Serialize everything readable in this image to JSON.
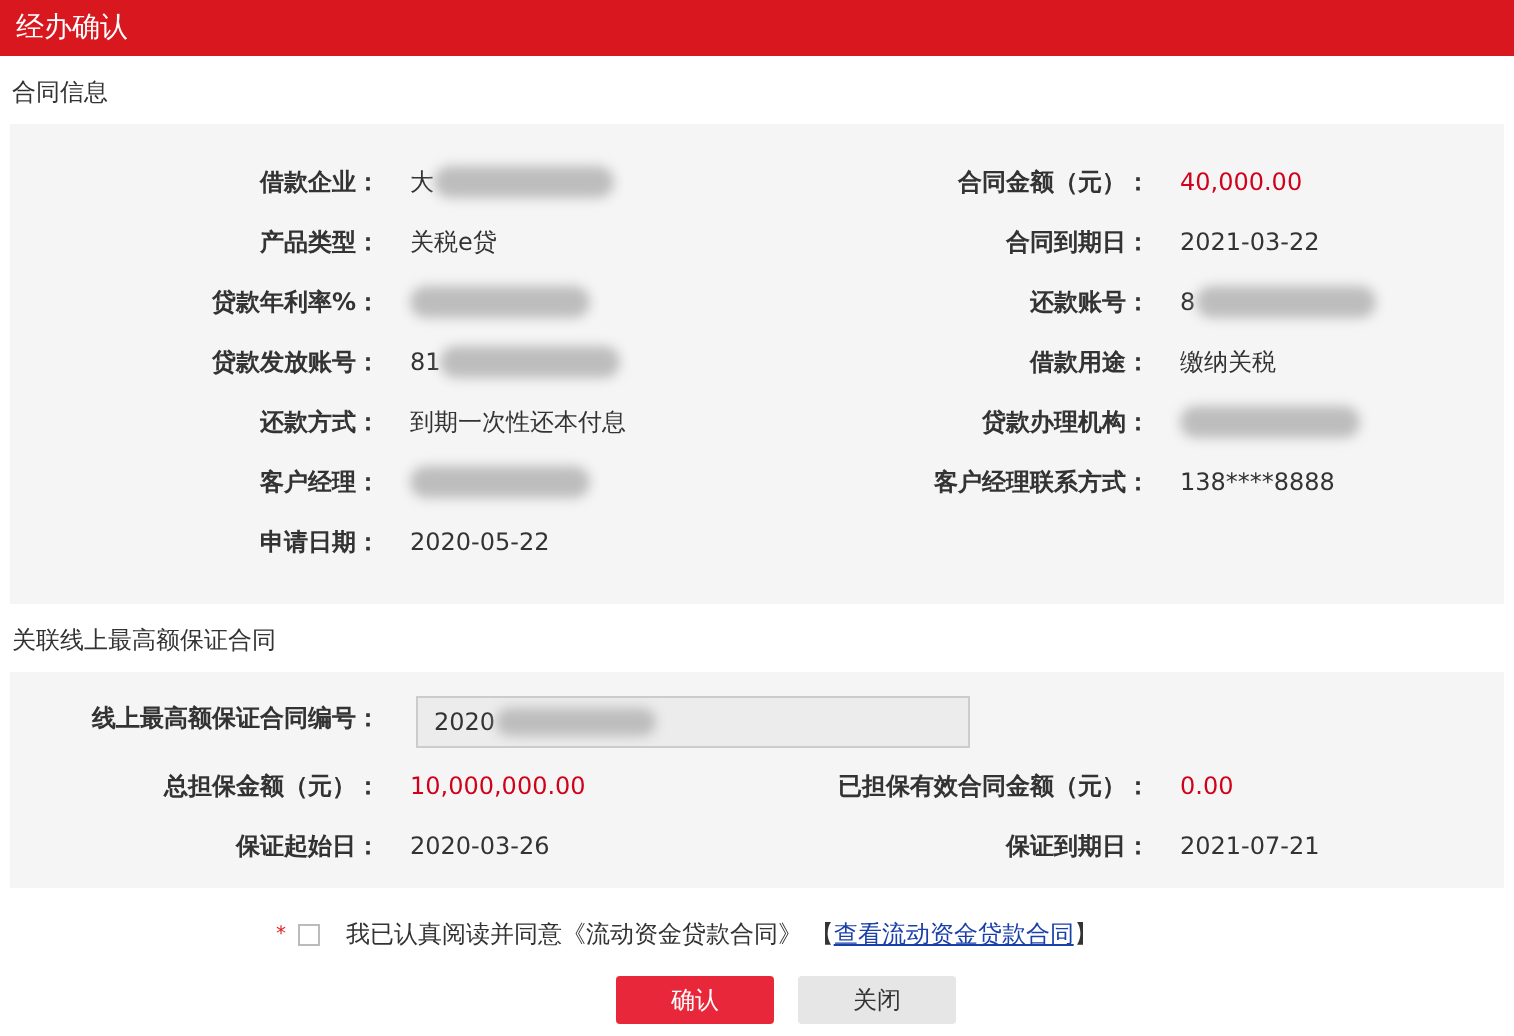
{
  "dialog": {
    "title": "经办确认"
  },
  "contract_info": {
    "heading": "合同信息",
    "rows": [
      {
        "left": {
          "label": "借款企业：",
          "kind": "redacted",
          "value": "大"
        },
        "right": {
          "label": "合同金额（元）：",
          "kind": "amount",
          "value": "40,000.00"
        }
      },
      {
        "left": {
          "label": "产品类型：",
          "kind": "plain",
          "value": "关税e贷"
        },
        "right": {
          "label": "合同到期日：",
          "kind": "plain",
          "value": "2021-03-22"
        }
      },
      {
        "left": {
          "label": "贷款年利率%：",
          "kind": "redacted"
        },
        "right": {
          "label": "还款账号：",
          "kind": "redacted",
          "value": "8"
        }
      },
      {
        "left": {
          "label": "贷款发放账号：",
          "kind": "redacted",
          "value": "81"
        },
        "right": {
          "label": "借款用途：",
          "kind": "plain",
          "value": "缴纳关税"
        }
      },
      {
        "left": {
          "label": "还款方式：",
          "kind": "plain",
          "value": "到期一次性还本付息"
        },
        "right": {
          "label": "贷款办理机构：",
          "kind": "redacted"
        }
      },
      {
        "left": {
          "label": "客户经理：",
          "kind": "redacted"
        },
        "right": {
          "label": "客户经理联系方式：",
          "kind": "plain",
          "value": "138****8888"
        }
      },
      {
        "left": {
          "label": "申请日期：",
          "kind": "plain",
          "value": "2020-05-22"
        }
      }
    ]
  },
  "guarantee": {
    "heading": "关联线上最高额保证合同",
    "contract_number": {
      "label": "线上最高额保证合同编号：",
      "value": "2020",
      "redacted": true
    },
    "rows": [
      {
        "left": {
          "label": "总担保金额（元）：",
          "kind": "amount",
          "value": "10,000,000.00"
        },
        "right": {
          "label": "已担保有效合同金额（元）：",
          "kind": "amount",
          "value": "0.00"
        }
      },
      {
        "left": {
          "label": "保证起始日：",
          "kind": "plain",
          "value": "2020-03-26"
        },
        "right": {
          "label": "保证到期日：",
          "kind": "plain",
          "value": "2021-07-21"
        }
      }
    ]
  },
  "agreement": {
    "required_mark": "*",
    "checked": false,
    "text": "我已认真阅读并同意《流动资金贷款合同》",
    "link_open": "【",
    "link": "查看流动资金贷款合同",
    "link_close": "】"
  },
  "buttons": [
    {
      "label": "确认",
      "kind": "primary"
    },
    {
      "label": "关闭",
      "kind": "secondary"
    }
  ]
}
